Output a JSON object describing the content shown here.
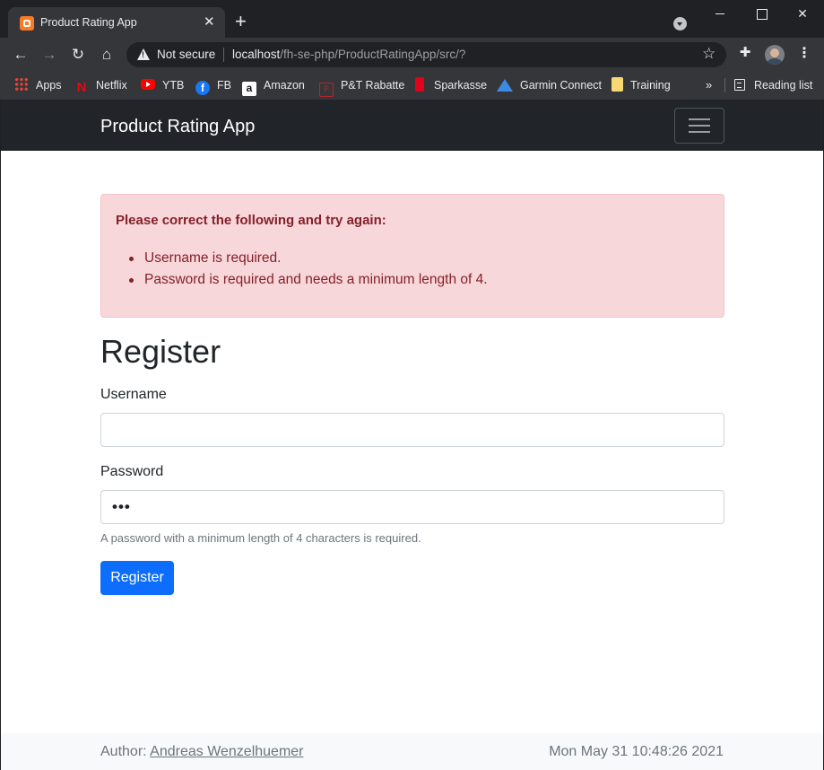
{
  "browser": {
    "tab_title": "Product Rating App",
    "tab_close": "✕",
    "new_tab": "+",
    "security_label": "Not secure",
    "url_host": "localhost",
    "url_path": "/fh-se-php/ProductRatingApp/src/?",
    "bookmarks": [
      {
        "label": "Apps",
        "icon": "apps-grid-icon"
      },
      {
        "label": "Netflix",
        "icon": "netflix-icon"
      },
      {
        "label": "YTB",
        "icon": "youtube-icon"
      },
      {
        "label": "FB",
        "icon": "facebook-icon"
      },
      {
        "label": "Amazon",
        "icon": "amazon-icon"
      },
      {
        "label": "P&T Rabatte",
        "icon": "pt-icon"
      },
      {
        "label": "Sparkasse",
        "icon": "sparkasse-icon"
      },
      {
        "label": "Garmin Connect",
        "icon": "garmin-icon"
      },
      {
        "label": "Training",
        "icon": "folder-icon"
      }
    ],
    "bookmarks_more": "»",
    "reading_list": "Reading list"
  },
  "app": {
    "brand": "Product Rating App",
    "alert": {
      "heading": "Please correct the following and try again:",
      "items": [
        "Username is required.",
        "Password is required and needs a minimum length of 4."
      ]
    },
    "form": {
      "title": "Register",
      "username_label": "Username",
      "username_value": "",
      "password_label": "Password",
      "password_value": "•••",
      "password_hint": "A password with a minimum length of 4 characters is required.",
      "submit_label": "Register"
    },
    "footer": {
      "author_prefix": "Author: ",
      "author_name": "Andreas Wenzelhuemer",
      "datetime": "Mon May 31 10:48:26 2021"
    }
  },
  "colors": {
    "navbar": "#212529",
    "alert_bg": "#f8d7da",
    "alert_text": "#842029",
    "primary": "#0d6efd"
  }
}
